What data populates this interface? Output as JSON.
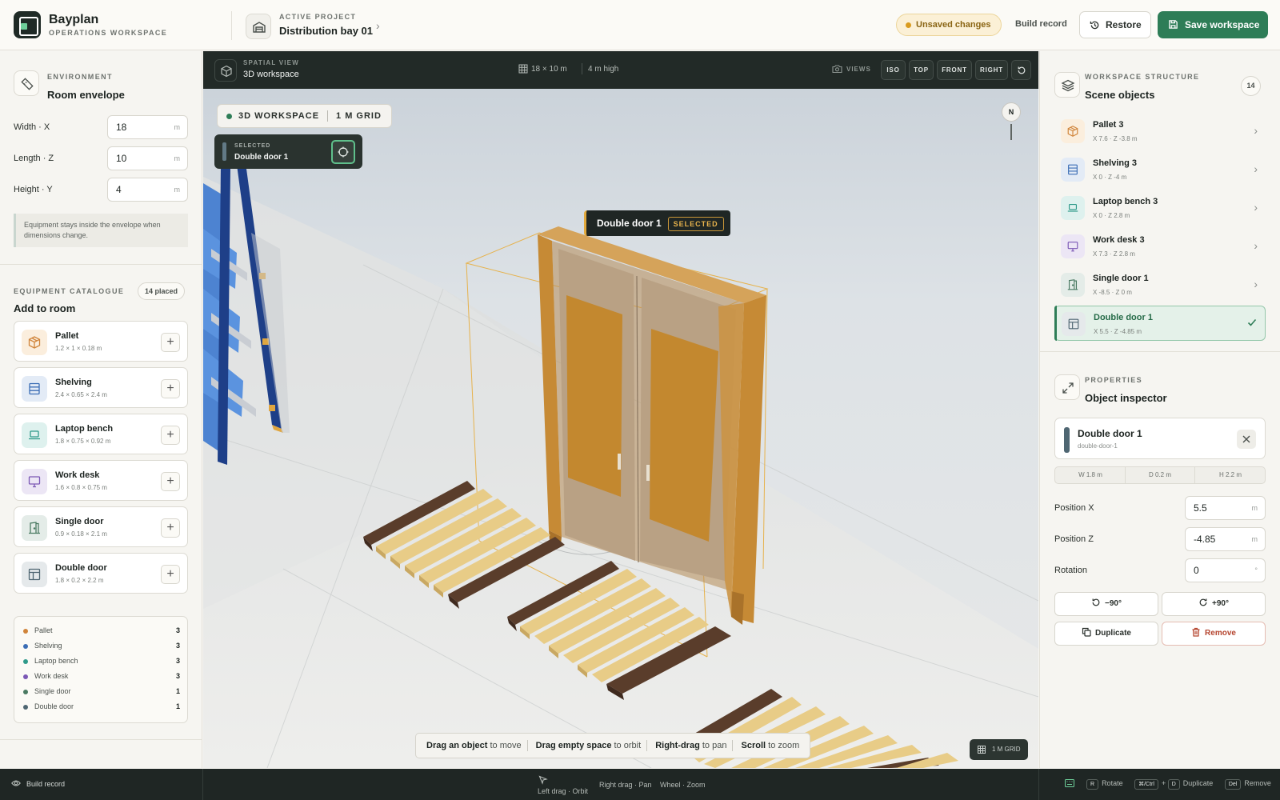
{
  "header": {
    "brand_name": "Bayplan",
    "brand_sub": "OPERATIONS WORKSPACE",
    "project_label": "ACTIVE PROJECT",
    "project_name": "Distribution bay 01",
    "unsaved": "Unsaved changes",
    "build_record": "Build record",
    "restore": "Restore",
    "save": "Save workspace"
  },
  "environment": {
    "kicker": "ENVIRONMENT",
    "title": "Room envelope",
    "fields": [
      {
        "label": "Width · X",
        "value": "18",
        "unit": "m"
      },
      {
        "label": "Length · Z",
        "value": "10",
        "unit": "m"
      },
      {
        "label": "Height · Y",
        "value": "4",
        "unit": "m"
      }
    ],
    "note": "Equipment stays inside the envelope when dimensions change."
  },
  "catalogue": {
    "kicker": "EQUIPMENT CATALOGUE",
    "title": "Add to room",
    "placed": "14 placed",
    "items": [
      {
        "name": "Pallet",
        "dims": "1.2 × 1 × 0.18 m",
        "icon": "box-icon",
        "bg": "#fbeedd",
        "fg": "#d0843a"
      },
      {
        "name": "Shelving",
        "dims": "2.4 × 0.65 × 2.4 m",
        "icon": "shelf-icon",
        "bg": "#e3ebf6",
        "fg": "#3b6db5"
      },
      {
        "name": "Laptop bench",
        "dims": "1.8 × 0.75 × 0.92 m",
        "icon": "laptop-icon",
        "bg": "#def1ee",
        "fg": "#2f9a8a"
      },
      {
        "name": "Work desk",
        "dims": "1.6 × 0.8 × 0.75 m",
        "icon": "monitor-icon",
        "bg": "#ece6f5",
        "fg": "#7b58b5"
      },
      {
        "name": "Single door",
        "dims": "0.9 × 0.18 × 2.1 m",
        "icon": "door-icon",
        "bg": "#e4ece8",
        "fg": "#4a7a62"
      },
      {
        "name": "Double door",
        "dims": "1.8 × 0.2 × 2.2 m",
        "icon": "double-door-icon",
        "bg": "#e5e9eb",
        "fg": "#4f6672"
      }
    ],
    "counts": [
      {
        "label": "Pallet",
        "value": "3",
        "color": "#d0843a"
      },
      {
        "label": "Shelving",
        "value": "3",
        "color": "#3b6db5"
      },
      {
        "label": "Laptop bench",
        "value": "3",
        "color": "#2f9a8a"
      },
      {
        "label": "Work desk",
        "value": "3",
        "color": "#7b58b5"
      },
      {
        "label": "Single door",
        "value": "1",
        "color": "#4a7a62"
      },
      {
        "label": "Double door",
        "value": "1",
        "color": "#4f6672"
      }
    ]
  },
  "viewport": {
    "kicker": "SPATIAL VIEW",
    "title": "3D workspace",
    "dims": "18 × 10 m",
    "height": "4 m high",
    "views_label": "VIEWS",
    "views": [
      "ISO",
      "TOP",
      "FRONT",
      "RIGHT"
    ],
    "mode_chip": "3D WORKSPACE",
    "grid_chip": "1 M GRID",
    "selected_kicker": "SELECTED",
    "selected_name": "Double door 1",
    "compass": "N",
    "tooltip_name": "Double door 1",
    "tooltip_tag": "SELECTED",
    "hints": [
      {
        "key": "Drag an object",
        "text": "to move"
      },
      {
        "key": "Drag empty space",
        "text": "to orbit"
      },
      {
        "key": "Right-drag",
        "text": "to pan"
      },
      {
        "key": "Scroll",
        "text": "to zoom"
      }
    ],
    "grid_badge": "1 M GRID"
  },
  "structure": {
    "kicker": "WORKSPACE STRUCTURE",
    "title": "Scene objects",
    "count": "14",
    "objects": [
      {
        "name": "Pallet 3",
        "pos": "X 7.6 · Z -3.8 m",
        "bg": "#fbeedd",
        "fg": "#d0843a",
        "selected": false
      },
      {
        "name": "Shelving 3",
        "pos": "X 0 · Z -4 m",
        "bg": "#e3ebf6",
        "fg": "#3b6db5",
        "selected": false
      },
      {
        "name": "Laptop bench 3",
        "pos": "X 0 · Z 2.8 m",
        "bg": "#def1ee",
        "fg": "#2f9a8a",
        "selected": false
      },
      {
        "name": "Work desk 3",
        "pos": "X 7.3 · Z 2.8 m",
        "bg": "#ece6f5",
        "fg": "#7b58b5",
        "selected": false
      },
      {
        "name": "Single door 1",
        "pos": "X -8.5 · Z 0 m",
        "bg": "#e4ece8",
        "fg": "#4a7a62",
        "selected": false
      },
      {
        "name": "Double door 1",
        "pos": "X 5.5 · Z -4.85 m",
        "bg": "#e5e9eb",
        "fg": "#4f6672",
        "selected": true
      }
    ]
  },
  "inspector": {
    "kicker": "PROPERTIES",
    "title": "Object inspector",
    "name": "Double door 1",
    "id": "double-door-1",
    "dims": [
      "W 1.8 m",
      "D 0.2 m",
      "H 2.2 m"
    ],
    "fields": [
      {
        "label": "Position X",
        "value": "5.5",
        "unit": "m"
      },
      {
        "label": "Position Z",
        "value": "-4.85",
        "unit": "m"
      },
      {
        "label": "Rotation",
        "value": "0",
        "unit": "°"
      }
    ],
    "rotate_left": "−90°",
    "rotate_right": "+90°",
    "duplicate": "Duplicate",
    "remove": "Remove"
  },
  "footer": {
    "build": "Build record",
    "left_drag": "Left drag · Orbit",
    "right_drag": "Right drag · Pan",
    "wheel": "Wheel · Zoom",
    "rotate_key": "R",
    "rotate_label": "Rotate",
    "dup_key1": "⌘/Ctrl",
    "dup_plus": "+",
    "dup_key2": "D",
    "dup_label": "Duplicate",
    "del_key": "Del",
    "del_label": "Remove"
  }
}
